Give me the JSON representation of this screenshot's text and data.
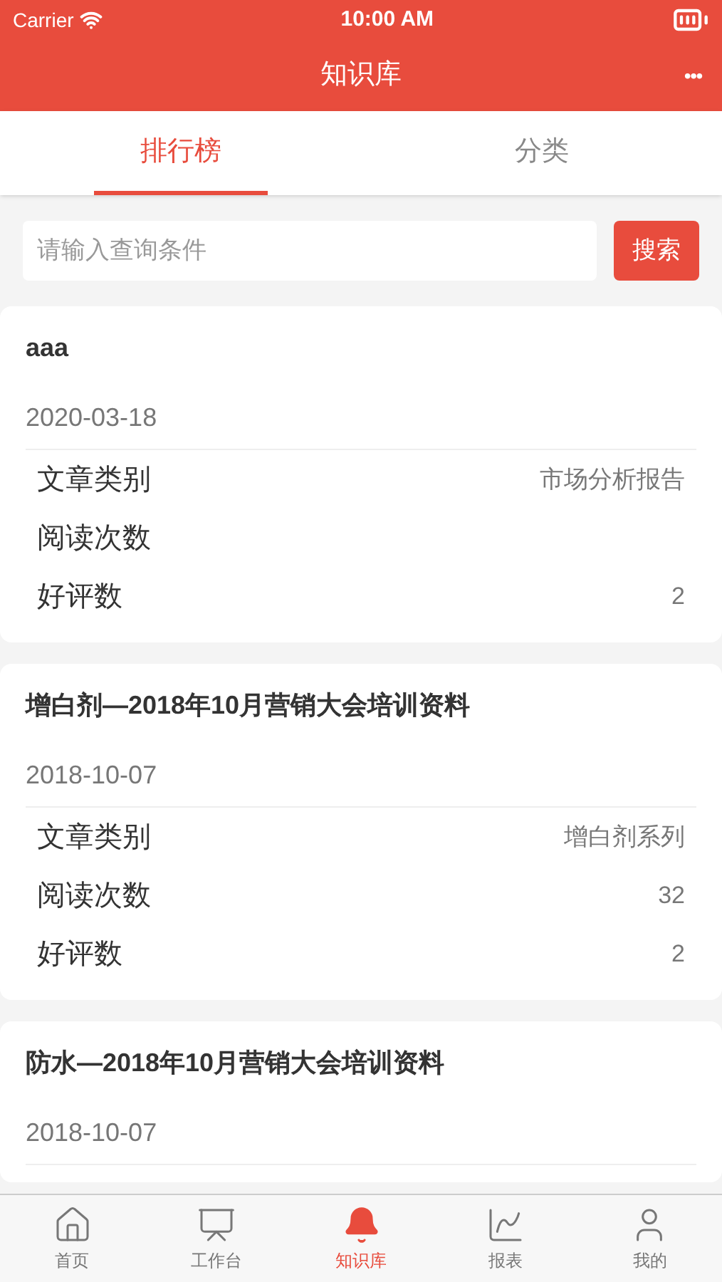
{
  "status_bar": {
    "carrier": "Carrier",
    "time": "10:00 AM"
  },
  "nav": {
    "title": "知识库",
    "menu": "•••"
  },
  "tabs": [
    {
      "label": "排行榜",
      "selected": true
    },
    {
      "label": "分类",
      "selected": false
    }
  ],
  "search": {
    "placeholder": "请输入查询条件",
    "button": "搜索"
  },
  "articles": [
    {
      "title": "aaa",
      "date": "2020-03-18",
      "rows": [
        {
          "label": "文章类别",
          "value": "市场分析报告"
        },
        {
          "label": "阅读次数"
        },
        {
          "label": "好评数",
          "value": "2"
        }
      ]
    },
    {
      "title": "增白剂—2018年10月营销大会培训资料",
      "date": "2018-10-07",
      "rows": [
        {
          "label": "文章类别",
          "value": "增白剂系列"
        },
        {
          "label": "阅读次数",
          "value": "32"
        },
        {
          "label": "好评数",
          "value": "2"
        }
      ]
    },
    {
      "title": "防水—2018年10月营销大会培训资料",
      "date": "2018-10-07"
    }
  ],
  "tab_bar": [
    {
      "kind": "home",
      "label": "首页",
      "selected": false
    },
    {
      "kind": "monitor",
      "label": "工作台",
      "selected": false
    },
    {
      "kind": "bell",
      "label": "知识库",
      "selected": true
    },
    {
      "kind": "chart",
      "label": "报表",
      "selected": false
    },
    {
      "kind": "user",
      "label": "我的",
      "selected": false
    }
  ]
}
